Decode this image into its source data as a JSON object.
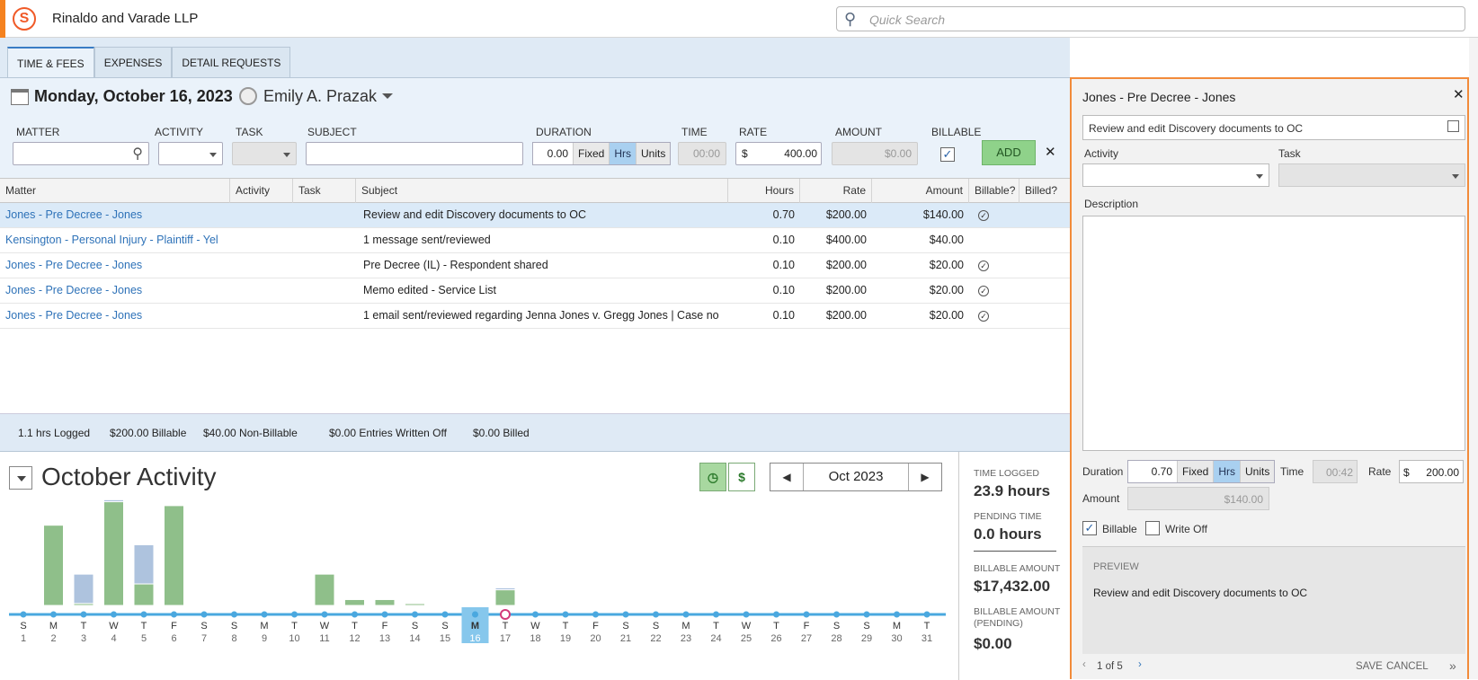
{
  "header": {
    "firm": "Rinaldo and Varade LLP",
    "search_placeholder": "Quick Search"
  },
  "tabs": [
    {
      "label": "TIME & FEES"
    },
    {
      "label": "EXPENSES"
    },
    {
      "label": "DETAIL REQUESTS"
    }
  ],
  "date_row": {
    "date": "Monday, October 16, 2023",
    "user": "Emily A. Prazak"
  },
  "entry": {
    "labels": {
      "matter": "MATTER",
      "activity": "ACTIVITY",
      "task": "TASK",
      "subject": "SUBJECT",
      "duration": "DURATION",
      "time": "TIME",
      "rate": "RATE",
      "amount": "AMOUNT",
      "billable": "BILLABLE"
    },
    "duration_value": "0.00",
    "fixed": "Fixed",
    "hrs": "Hrs",
    "units": "Units",
    "time_value": "00:00",
    "rate_currency": "$",
    "rate_value": "400.00",
    "amount_value": "$0.00",
    "add": "ADD",
    "close": "✕"
  },
  "table": {
    "headers": [
      "Matter",
      "Activity",
      "Task",
      "Subject",
      "Hours",
      "Rate",
      "Amount",
      "Billable?",
      "Billed?"
    ],
    "rows": [
      {
        "matter": "Jones - Pre Decree - Jones",
        "subject": "Review and edit Discovery documents to OC",
        "hours": "0.70",
        "rate": "$200.00",
        "amount": "$140.00",
        "billable": true
      },
      {
        "matter": "Kensington - Personal Injury - Plaintiff - Yel",
        "subject": "1 message sent/reviewed",
        "hours": "0.10",
        "rate": "$400.00",
        "amount": "$40.00",
        "billable": false
      },
      {
        "matter": "Jones - Pre Decree - Jones",
        "subject": "Pre Decree (IL) - Respondent shared",
        "hours": "0.10",
        "rate": "$200.00",
        "amount": "$20.00",
        "billable": true
      },
      {
        "matter": "Jones - Pre Decree - Jones",
        "subject": "Memo edited - Service List",
        "hours": "0.10",
        "rate": "$200.00",
        "amount": "$20.00",
        "billable": true
      },
      {
        "matter": "Jones - Pre Decree - Jones",
        "subject": "1 email sent/reviewed regarding Jenna Jones v. Gregg Jones | Case no",
        "hours": "0.10",
        "rate": "$200.00",
        "amount": "$20.00",
        "billable": true
      }
    ]
  },
  "summary": {
    "logged": "1.1 hrs Logged",
    "billable": "$200.00 Billable",
    "non_billable": "$40.00 Non-Billable",
    "written_off": "$0.00 Entries Written Off",
    "billed": "$0.00 Billed"
  },
  "activity": {
    "title": "October Activity",
    "month": "Oct 2023",
    "toggle_time_icon": "clock-icon",
    "toggle_money": "$"
  },
  "chart_data": {
    "type": "bar",
    "days": [
      {
        "d": "S",
        "n": "1"
      },
      {
        "d": "M",
        "n": "2"
      },
      {
        "d": "T",
        "n": "3"
      },
      {
        "d": "W",
        "n": "4"
      },
      {
        "d": "T",
        "n": "5"
      },
      {
        "d": "F",
        "n": "6"
      },
      {
        "d": "S",
        "n": "7"
      },
      {
        "d": "S",
        "n": "8"
      },
      {
        "d": "M",
        "n": "9"
      },
      {
        "d": "T",
        "n": "10"
      },
      {
        "d": "W",
        "n": "11"
      },
      {
        "d": "T",
        "n": "12"
      },
      {
        "d": "F",
        "n": "13"
      },
      {
        "d": "S",
        "n": "14"
      },
      {
        "d": "S",
        "n": "15"
      },
      {
        "d": "M",
        "n": "16"
      },
      {
        "d": "T",
        "n": "17"
      },
      {
        "d": "W",
        "n": "18"
      },
      {
        "d": "T",
        "n": "19"
      },
      {
        "d": "F",
        "n": "20"
      },
      {
        "d": "S",
        "n": "21"
      },
      {
        "d": "S",
        "n": "22"
      },
      {
        "d": "M",
        "n": "23"
      },
      {
        "d": "T",
        "n": "24"
      },
      {
        "d": "W",
        "n": "25"
      },
      {
        "d": "T",
        "n": "26"
      },
      {
        "d": "F",
        "n": "27"
      },
      {
        "d": "S",
        "n": "28"
      },
      {
        "d": "S",
        "n": "29"
      },
      {
        "d": "M",
        "n": "30"
      },
      {
        "d": "T",
        "n": "31"
      }
    ],
    "series": [
      {
        "color": "#8fbf8a",
        "values": [
          0,
          4.1,
          0.1,
          5.3,
          1.1,
          5.1,
          0,
          0,
          0,
          0,
          1.6,
          0.3,
          0.3,
          0.05,
          0,
          0,
          0.8,
          0,
          0,
          0,
          0,
          0,
          0,
          0,
          0,
          0,
          0,
          0,
          0,
          0,
          0
        ]
      },
      {
        "color": "#aec3de",
        "values": [
          0,
          0,
          1.5,
          0.1,
          2.0,
          0,
          0,
          0,
          0,
          0,
          0,
          0,
          0,
          0,
          0,
          0,
          0.1,
          0,
          0,
          0,
          0,
          0,
          0,
          0,
          0,
          0,
          0,
          0,
          0,
          0,
          0
        ]
      }
    ],
    "ylim": [
      0,
      5.6
    ],
    "selected_day": "16",
    "today_marker_day": "17"
  },
  "stats": {
    "time_logged_label": "TIME LOGGED",
    "time_logged": "23.9 hours",
    "pending_label": "PENDING TIME",
    "pending": "0.0 hours",
    "billable_label": "BILLABLE AMOUNT",
    "billable": "$17,432.00",
    "billable_pending_label": "BILLABLE AMOUNT (PENDING)",
    "billable_pending": "$0.00"
  },
  "panel": {
    "title": "Jones - Pre Decree - Jones",
    "close": "✕",
    "subject": "Review and edit Discovery documents to OC",
    "activity_label": "Activity",
    "task_label": "Task",
    "description_label": "Description",
    "duration_label": "Duration",
    "duration": "0.70",
    "fixed": "Fixed",
    "hrs": "Hrs",
    "units": "Units",
    "time_label": "Time",
    "time": "00:42",
    "rate_label": "Rate",
    "rate_currency": "$",
    "rate": "200.00",
    "amount_label": "Amount",
    "amount": "$140.00",
    "billable_label": "Billable",
    "writeoff_label": "Write Off",
    "preview_label": "PREVIEW",
    "preview_text": "Review and edit Discovery documents to OC",
    "pager": "1 of 5",
    "save": "SAVE",
    "cancel": "CANCEL"
  }
}
